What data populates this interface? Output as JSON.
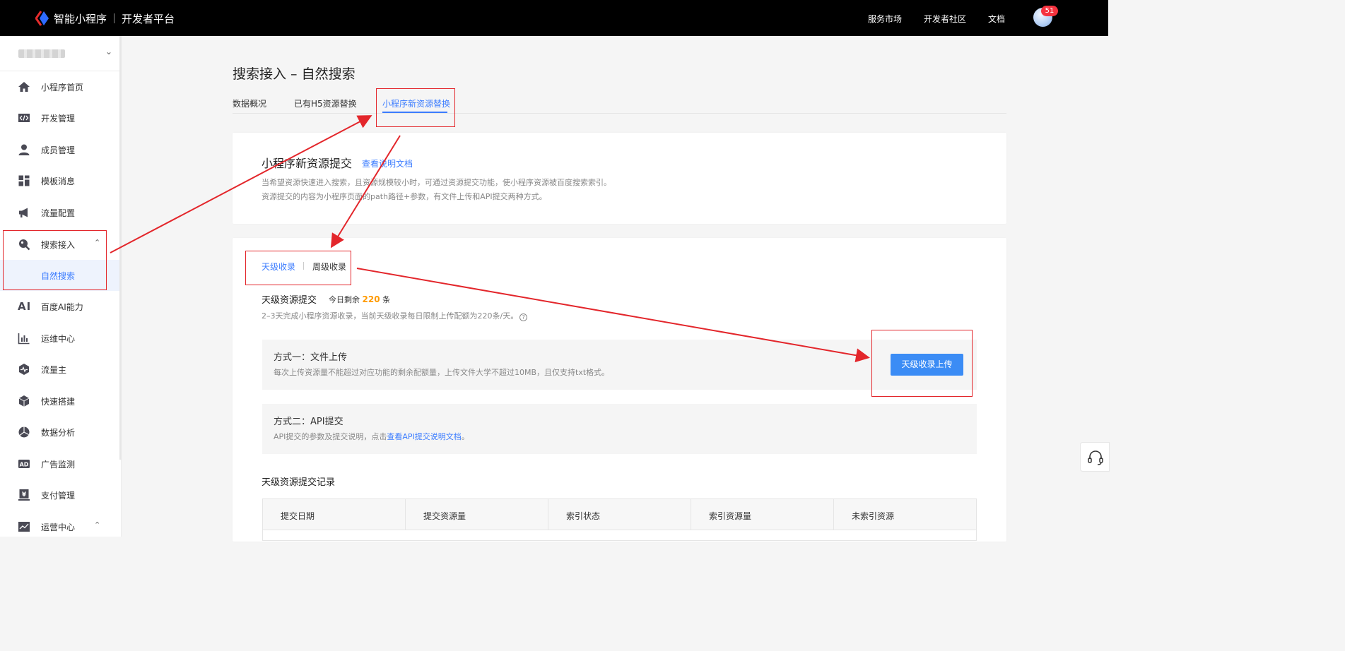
{
  "topbar": {
    "brand_name": "智能小程序",
    "brand_sub": "开发者平台",
    "nav": [
      "服务市场",
      "开发者社区",
      "文档"
    ],
    "notification_count": "51"
  },
  "sidebar": {
    "items": [
      {
        "label": "小程序首页",
        "icon": "home-icon"
      },
      {
        "label": "开发管理",
        "icon": "code-icon"
      },
      {
        "label": "成员管理",
        "icon": "user-icon"
      },
      {
        "label": "模板消息",
        "icon": "template-icon"
      },
      {
        "label": "流量配置",
        "icon": "megaphone-icon"
      },
      {
        "label": "搜索接入",
        "icon": "search-icon"
      },
      {
        "label": "自然搜索",
        "icon": ""
      },
      {
        "label": "百度AI能力",
        "icon": "ai-icon"
      },
      {
        "label": "运维中心",
        "icon": "bar-chart-icon"
      },
      {
        "label": "流量主",
        "icon": "pulse-icon"
      },
      {
        "label": "快速搭建",
        "icon": "cube-icon"
      },
      {
        "label": "数据分析",
        "icon": "pie-chart-icon"
      },
      {
        "label": "广告监测",
        "icon": "ad-icon"
      },
      {
        "label": "支付管理",
        "icon": "yuan-icon"
      },
      {
        "label": "运营中心",
        "icon": "line-chart-icon"
      }
    ]
  },
  "main": {
    "page_title": "搜索接入 – 自然搜索",
    "tabs": [
      "数据概况",
      "已有H5资源替换",
      "小程序新资源替换"
    ],
    "intro": {
      "title": "小程序新资源提交",
      "doc_link": "查看说明文档",
      "desc1": "当希望资源快速进入搜索，且资源规模较小时，可通过资源提交功能，使小程序资源被百度搜索索引。",
      "desc2": "资源提交的内容为小程序页面的path路径+参数，有文件上传和API提交两种方式。"
    },
    "subtabs": [
      "天级收录",
      "周级收录"
    ],
    "quota": {
      "title": "天级资源提交",
      "prefix": "今日剩余",
      "remaining": "220",
      "suffix": "条",
      "note": "2–3天完成小程序资源收录，当前天级收录每日限制上传配额为220条/天。"
    },
    "method1": {
      "title": "方式一：文件上传",
      "desc": "每次上传资源量不能超过对应功能的剩余配额量，上传文件大学不超过10MB，且仅支持txt格式。",
      "button": "天级收录上传"
    },
    "method2": {
      "title": "方式二：API提交",
      "desc_prefix": "API提交的参数及提交说明，点击",
      "link": "查看API提交说明文档",
      "desc_suffix": "。"
    },
    "records": {
      "title": "天级资源提交记录",
      "columns": [
        "提交日期",
        "提交资源量",
        "索引状态",
        "索引资源量",
        "未索引资源"
      ]
    }
  },
  "colors": {
    "accent": "#3b7cff",
    "highlight_number": "#ff9a00",
    "annotation": "#e3262b"
  }
}
